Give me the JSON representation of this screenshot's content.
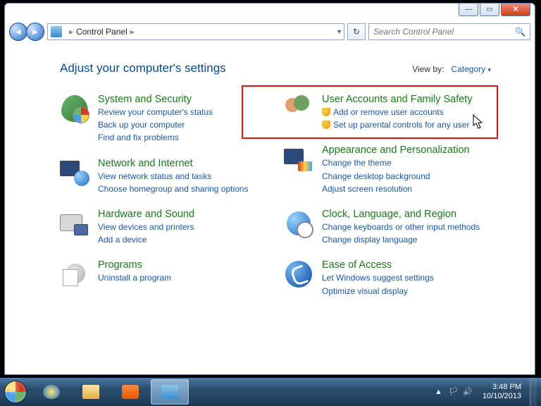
{
  "window_controls": {
    "min": "—",
    "max": "▭",
    "close": "✕"
  },
  "nav": {
    "back": "◄",
    "forward": "►",
    "refresh": "↻"
  },
  "breadcrumb": {
    "root_icon": "control-panel-icon",
    "item1": "Control Panel",
    "sep": "▸"
  },
  "addrbar": {
    "dropdown": "▾"
  },
  "search": {
    "placeholder": "Search Control Panel",
    "icon": "🔍"
  },
  "heading": "Adjust your computer's settings",
  "viewby": {
    "label": "View by:",
    "value": "Category",
    "arrow": "▾"
  },
  "left_cats": [
    {
      "icon": "sec",
      "title": "System and Security",
      "links": [
        "Review your computer's status",
        "Back up your computer",
        "Find and fix problems"
      ]
    },
    {
      "icon": "net",
      "title": "Network and Internet",
      "links": [
        "View network status and tasks",
        "Choose homegroup and sharing options"
      ]
    },
    {
      "icon": "hw",
      "title": "Hardware and Sound",
      "links": [
        "View devices and printers",
        "Add a device"
      ]
    },
    {
      "icon": "prog",
      "title": "Programs",
      "links": [
        "Uninstall a program"
      ]
    }
  ],
  "right_cats": [
    {
      "icon": "user",
      "title": "User Accounts and Family Safety",
      "shielded": true,
      "links": [
        "Add or remove user accounts",
        "Set up parental controls for any user"
      ]
    },
    {
      "icon": "appr",
      "title": "Appearance and Personalization",
      "links": [
        "Change the theme",
        "Change desktop background",
        "Adjust screen resolution"
      ]
    },
    {
      "icon": "clk",
      "title": "Clock, Language, and Region",
      "links": [
        "Change keyboards or other input methods",
        "Change display language"
      ]
    },
    {
      "icon": "eoa",
      "title": "Ease of Access",
      "links": [
        "Let Windows suggest settings",
        "Optimize visual display"
      ]
    }
  ],
  "highlight_category_index": 0,
  "taskbar": {
    "pinned": [
      "ie",
      "exp",
      "wmp",
      "cp"
    ],
    "active_index": 3,
    "tray_icons": [
      "▲",
      "🏳",
      "🔊"
    ],
    "time": "3:48 PM",
    "date": "10/10/2013"
  }
}
